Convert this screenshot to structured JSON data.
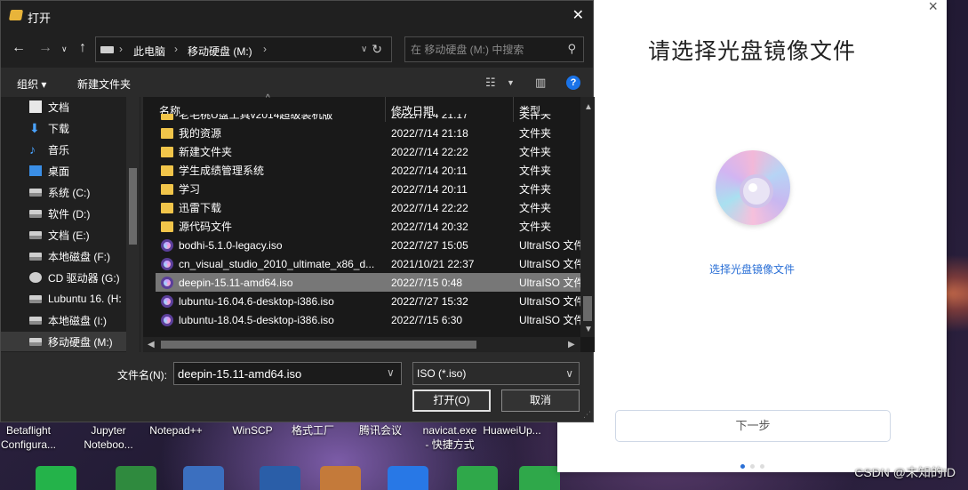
{
  "desktop": {
    "icons": [
      {
        "label": "Betaflight\nConfigura...",
        "color": "#24b34a"
      },
      {
        "label": "Jupyter\nNoteboo...",
        "color": "#2f8a3e"
      },
      {
        "label": "Notepad++",
        "color": "#3b6fbf"
      },
      {
        "label": "WinSCP",
        "color": "#2a5ea8"
      },
      {
        "label": "格式工厂",
        "color": "#c47a3a"
      },
      {
        "label": "腾讯会议",
        "color": "#2878e6"
      },
      {
        "label": "navicat.exe\n- 快捷方式",
        "color": "#2fa84a"
      },
      {
        "label": "HuaweiUp...",
        "color": "#2fa84a"
      }
    ]
  },
  "installer": {
    "close_icon": "×",
    "title": "请选择光盘镜像文件",
    "link": "选择光盘镜像文件",
    "next": "下一步",
    "accent": "#2a6fd6"
  },
  "watermark": "CSDN @未知的ID",
  "dialog": {
    "title": "打开",
    "close_icon": "✕",
    "address": [
      "此电脑",
      "移动硬盘 (M:)"
    ],
    "search_placeholder": "在 移动硬盘 (M:) 中搜索",
    "organize": "组织 ▾",
    "new_folder": "新建文件夹",
    "nav_items": [
      {
        "label": "文档",
        "icon": "doc"
      },
      {
        "label": "下载",
        "icon": "down"
      },
      {
        "label": "音乐",
        "icon": "music"
      },
      {
        "label": "桌面",
        "icon": "desk"
      },
      {
        "label": "系统 (C:)",
        "icon": "drive"
      },
      {
        "label": "软件 (D:)",
        "icon": "drive"
      },
      {
        "label": "文档 (E:)",
        "icon": "drive"
      },
      {
        "label": "本地磁盘 (F:)",
        "icon": "drive"
      },
      {
        "label": "CD 驱动器 (G:)",
        "icon": "cd"
      },
      {
        "label": "Lubuntu 16. (H:",
        "icon": "drive"
      },
      {
        "label": "本地磁盘 (I:)",
        "icon": "drive"
      },
      {
        "label": "移动硬盘 (M:)",
        "icon": "drive",
        "selected": true
      }
    ],
    "columns": {
      "name": "名称",
      "date": "修改日期",
      "type": "类型"
    },
    "files": [
      {
        "name": "老毛桃U盘工具v2014超级装机版",
        "date": "2022/7/14 21:17",
        "type": "文件夹",
        "kind": "folder"
      },
      {
        "name": "我的资源",
        "date": "2022/7/14 21:18",
        "type": "文件夹",
        "kind": "folder"
      },
      {
        "name": "新建文件夹",
        "date": "2022/7/14 22:22",
        "type": "文件夹",
        "kind": "folder"
      },
      {
        "name": "学生成绩管理系统",
        "date": "2022/7/14 20:11",
        "type": "文件夹",
        "kind": "folder"
      },
      {
        "name": "学习",
        "date": "2022/7/14 20:11",
        "type": "文件夹",
        "kind": "folder"
      },
      {
        "name": "迅雷下载",
        "date": "2022/7/14 22:22",
        "type": "文件夹",
        "kind": "folder"
      },
      {
        "name": "源代码文件",
        "date": "2022/7/14 20:32",
        "type": "文件夹",
        "kind": "folder"
      },
      {
        "name": "bodhi-5.1.0-legacy.iso",
        "date": "2022/7/27 15:05",
        "type": "UltraISO 文件",
        "kind": "iso"
      },
      {
        "name": "cn_visual_studio_2010_ultimate_x86_d...",
        "date": "2021/10/21 22:37",
        "type": "UltraISO 文件",
        "kind": "iso"
      },
      {
        "name": "deepin-15.11-amd64.iso",
        "date": "2022/7/15 0:48",
        "type": "UltraISO 文件",
        "kind": "iso",
        "selected": true
      },
      {
        "name": "lubuntu-16.04.6-desktop-i386.iso",
        "date": "2022/7/27 15:32",
        "type": "UltraISO 文件",
        "kind": "iso"
      },
      {
        "name": "lubuntu-18.04.5-desktop-i386.iso",
        "date": "2022/7/15 6:30",
        "type": "UltraISO 文件",
        "kind": "iso"
      }
    ],
    "filename_label": "文件名(N):",
    "filename_value": "deepin-15.11-amd64.iso",
    "filetype": "ISO (*.iso)",
    "open_button": "打开(O)",
    "cancel_button": "取消"
  }
}
